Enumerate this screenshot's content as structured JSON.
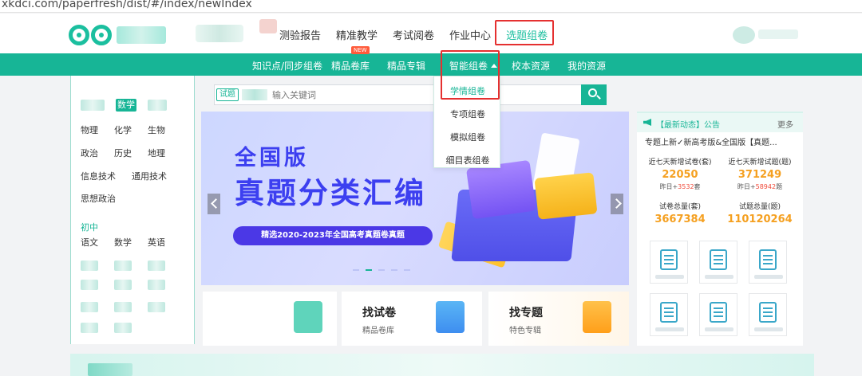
{
  "browser": {
    "url": "xkdci.com/paperfresh/dist/#/index/newIndex"
  },
  "header": {
    "nav": [
      "测验报告",
      "精准教学",
      "考试阅卷",
      "作业中心",
      "选题组卷"
    ],
    "active": "选题组卷"
  },
  "subnav": {
    "items": [
      "知识点/同步组卷",
      "精品卷库",
      "精品专辑",
      "智能组卷",
      "校本资源",
      "我的资源"
    ],
    "new_badge": "NEW"
  },
  "dropdown": {
    "options": [
      "学情组卷",
      "专项组卷",
      "模拟组卷",
      "细目表组卷"
    ],
    "selected": "学情组卷"
  },
  "search": {
    "tag": "试题",
    "placeholder": "输入关键词"
  },
  "sidebar": {
    "selected": "数学",
    "row1": [
      "物理",
      "化学",
      "生物"
    ],
    "row2": [
      "政治",
      "历史",
      "地理"
    ],
    "row3": [
      "信息技术",
      "通用技术"
    ],
    "row4": [
      "思想政治"
    ],
    "section": "初中",
    "row5": [
      "语文",
      "数学",
      "英语"
    ]
  },
  "banner": {
    "line1": "全国版",
    "line2": "真题分类汇编",
    "tagline": "精选2020-2023年全国高考真题卷真题"
  },
  "cards": [
    {
      "title": "找试卷",
      "subtitle": "精品卷库"
    },
    {
      "title": "找专题",
      "subtitle": "特色专辑"
    }
  ],
  "notice": {
    "title": "【最新动态】公告",
    "more": "更多",
    "headline": "专题上新✓新高考版&全国版【真题..."
  },
  "stats": [
    {
      "label": "近七天新增试卷(套)",
      "value": "22050",
      "inc_prefix": "昨日+",
      "inc": "3532",
      "inc_suffix": "套"
    },
    {
      "label": "近七天新增试题(题)",
      "value": "371249",
      "inc_prefix": "昨日+",
      "inc": "58942",
      "inc_suffix": "题"
    },
    {
      "label": "试卷总量(套)",
      "value": "3667384"
    },
    {
      "label": "试题总量(题)",
      "value": "110120264"
    }
  ],
  "colors": {
    "brand": "#17b596",
    "highlight": "#e53030",
    "stat_number": "#f5a020"
  }
}
